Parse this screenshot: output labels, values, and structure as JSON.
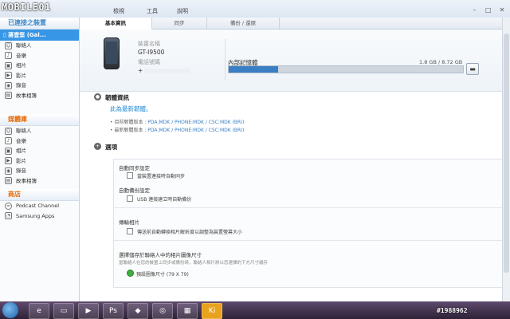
{
  "app": {
    "logo": "MOBILE01",
    "menu": [
      "檢視",
      "工具",
      "說明"
    ]
  },
  "sidebar": {
    "connected_header": "已連接之裝置",
    "device_name": "蔣壹堅 (Gal...",
    "device_items": [
      "聯絡人",
      "音樂",
      "相片",
      "影片",
      "錄音",
      "故事相簿"
    ],
    "library_header": "媒體庫",
    "library_items": [
      "聯絡人",
      "音樂",
      "相片",
      "影片",
      "錄音",
      "故事相簿"
    ],
    "store_header": "商店",
    "store_items": [
      "Podcast Channel",
      "Samsung Apps"
    ]
  },
  "tabs": [
    "基本資訊",
    "同步",
    "備份 / 還原"
  ],
  "device": {
    "name_label": "裝置名稱",
    "model": "GT-I9500",
    "phone_label": "電話號碼",
    "phone": "+"
  },
  "memory": {
    "label": "內部記憶體",
    "size": "1.8 GB / 8.72 GB",
    "used_fraction": 0.21
  },
  "firmware": {
    "title": "韌體資訊",
    "status": "此為最新韌體。",
    "current_label": "目前韌體版本 : ",
    "current_value": "PDA:MDK / PHONE:MDK / CSC:MDK (BRI)",
    "latest_label": "最新韌體版本 : ",
    "latest_value": "PDA:MDK / PHONE:MDK / CSC:MDK (BRI)"
  },
  "options": {
    "title": "選項",
    "auto_sync_title": "自動同步設定",
    "auto_sync_check": "當裝置連接時自動同步",
    "auto_backup_title": "自動備份設定",
    "auto_backup_check": "USB 連接建立時自動備份",
    "photo_title": "傳輸相片",
    "photo_check": "傳送前自動轉換相片解析度以調整為裝置螢幕大小",
    "contact_title": "選擇儲存於聯絡人中的相片圖像尺寸",
    "contact_hint": "當聯絡人在您的裝置上同步或備份時，聯絡人相片將以您選擇的下方尺寸儲存",
    "contact_radio": "預設圖像尺寸 (79 X 79)"
  },
  "taskbar": {
    "watermark": "#1988962"
  }
}
